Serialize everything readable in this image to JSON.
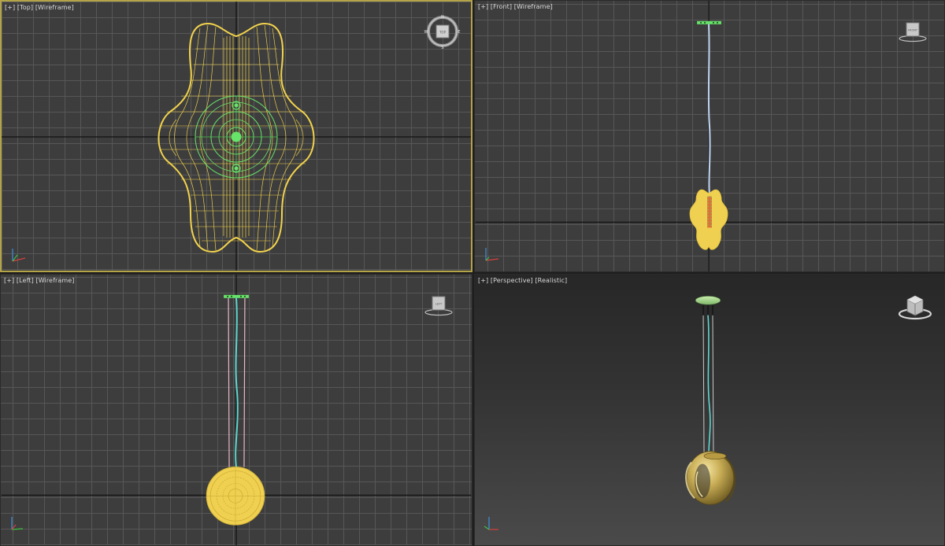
{
  "viewports": {
    "top": {
      "menu": "[+]",
      "view": "[Top]",
      "shading": "[Wireframe]"
    },
    "front": {
      "menu": "[+]",
      "view": "[Front]",
      "shading": "[Wireframe]"
    },
    "left": {
      "menu": "[+]",
      "view": "[Left]",
      "shading": "[Wireframe]"
    },
    "perspective": {
      "menu": "[+]",
      "view": "[Perspective]",
      "shading": "[Realistic]"
    }
  },
  "viewcube": {
    "top_compass": {
      "n": "N",
      "s": "S",
      "e": "E",
      "w": "W",
      "face": "TOP"
    },
    "front_face": "FRONT",
    "left_face": "LEFT"
  },
  "colors": {
    "active_border": "#b4a448",
    "wire_yellow": "#f2d34d",
    "selection_green": "#67e36a",
    "cable_cyan": "#5fd8d0",
    "cable_pink": "#e9b9c9"
  },
  "icons": {
    "axis_tripod": "axis-tripod-icon",
    "viewcube": "viewcube-icon",
    "compass": "compass-icon"
  }
}
